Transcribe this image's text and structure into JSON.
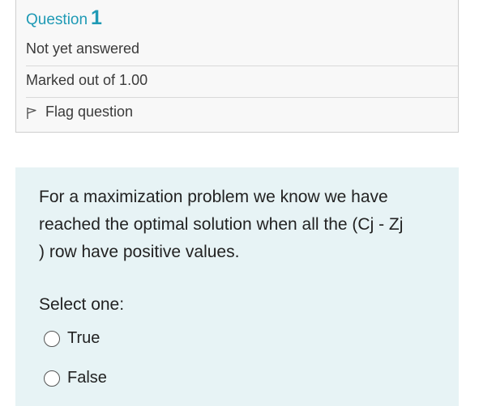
{
  "info": {
    "question_label": "Question",
    "question_number": "1",
    "state": "Not yet answered",
    "grade": "Marked out of 1.00",
    "flag_label": "Flag question"
  },
  "question": {
    "text": "For a maximization problem  we know we have\nreached the optimal solution when all the (Cj - Zj\n) row have positive values.",
    "prompt": "Select one:",
    "options": [
      {
        "label": "True",
        "selected": false
      },
      {
        "label": "False",
        "selected": false
      }
    ]
  },
  "colors": {
    "accent": "#1f9ab5",
    "content_background": "#e7f3f5",
    "info_background": "#f8f8f8"
  },
  "icons": {
    "flag": "flag-outline-icon",
    "radio": "radio-unchecked-icon"
  }
}
